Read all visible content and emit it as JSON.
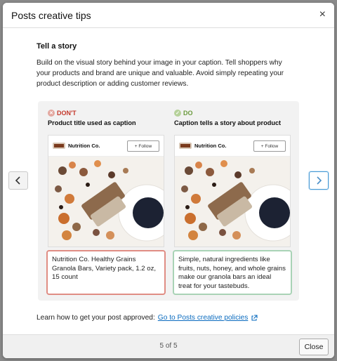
{
  "modal": {
    "title": "Posts creative tips",
    "close_glyph": "×"
  },
  "content": {
    "heading": "Tell a story",
    "description": "Build on the visual story behind your image in your caption. Tell shoppers why your products and brand are unique and valuable. Avoid simply repeating your product description or adding customer reviews."
  },
  "examples": [
    {
      "verdict": "DON'T",
      "verdict_icon": "x-circle-icon",
      "verdict_color": "#c4382b",
      "label": "Product title used as caption",
      "brand": "Nutrition Co.",
      "follow": "+ Follow",
      "caption": "Nutrition Co. Healthy Grains Granola Bars, Variety pack, 1.2 oz, 15 count"
    },
    {
      "verdict": "DO",
      "verdict_icon": "check-circle-icon",
      "verdict_color": "#6a9a3c",
      "label": "Caption tells a story about product",
      "brand": "Nutrition Co.",
      "follow": "+ Follow",
      "caption": "Simple, natural ingredients like fruits, nuts, honey, and whole grains make our granola bars an ideal treat for your tastebuds."
    }
  ],
  "footer": {
    "help_text": "Learn how to get your post approved:",
    "link_text": "Go to Posts creative policies",
    "link_icon": "external-link-icon",
    "page_indicator": "5 of 5",
    "close_label": "Close"
  },
  "colors": {
    "accent": "#0a6bbf",
    "dont_border": "#e08d84",
    "do_border": "#a9d3b6"
  }
}
